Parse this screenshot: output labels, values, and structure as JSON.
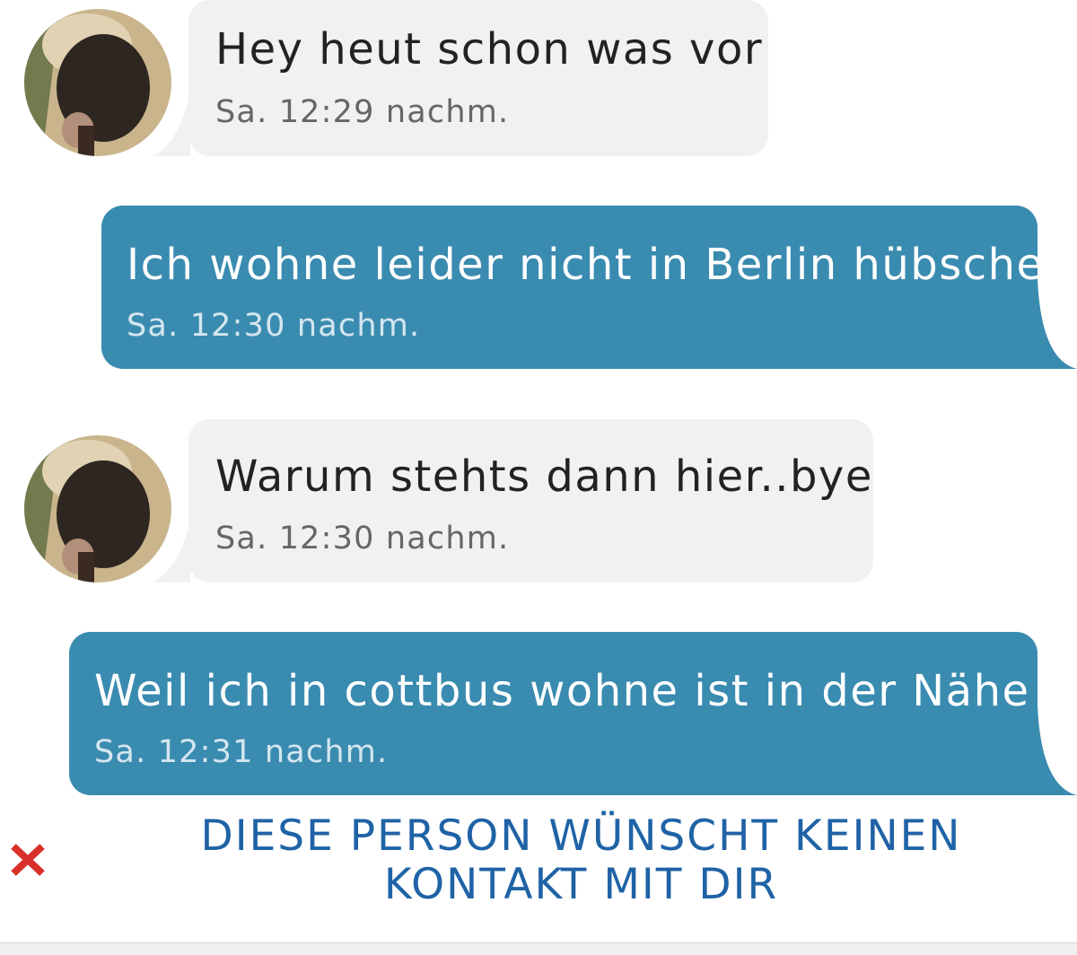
{
  "messages": [
    {
      "direction": "incoming",
      "text": "Hey heut schon was vor",
      "time": "Sa. 12:29 nachm."
    },
    {
      "direction": "outgoing",
      "text": "Ich wohne leider nicht in Berlin hübsche",
      "time": "Sa. 12:30 nachm."
    },
    {
      "direction": "incoming",
      "text": "Warum stehts dann hier..bye",
      "time": "Sa. 12:30 nachm."
    },
    {
      "direction": "outgoing",
      "text": "Weil ich in cottbus wohne ist in der Nähe",
      "time": "Sa. 12:31 nachm."
    }
  ],
  "notice": {
    "line1": "DIESE PERSON WÜNSCHT KEINEN",
    "line2": "KONTAKT MIT DIR",
    "icon": "close-icon"
  },
  "colors": {
    "outgoing_bubble": "#3a8bb0",
    "incoming_bubble": "#f1f1f1",
    "notice_text": "#1f63a6",
    "close_icon": "#d9302b"
  }
}
